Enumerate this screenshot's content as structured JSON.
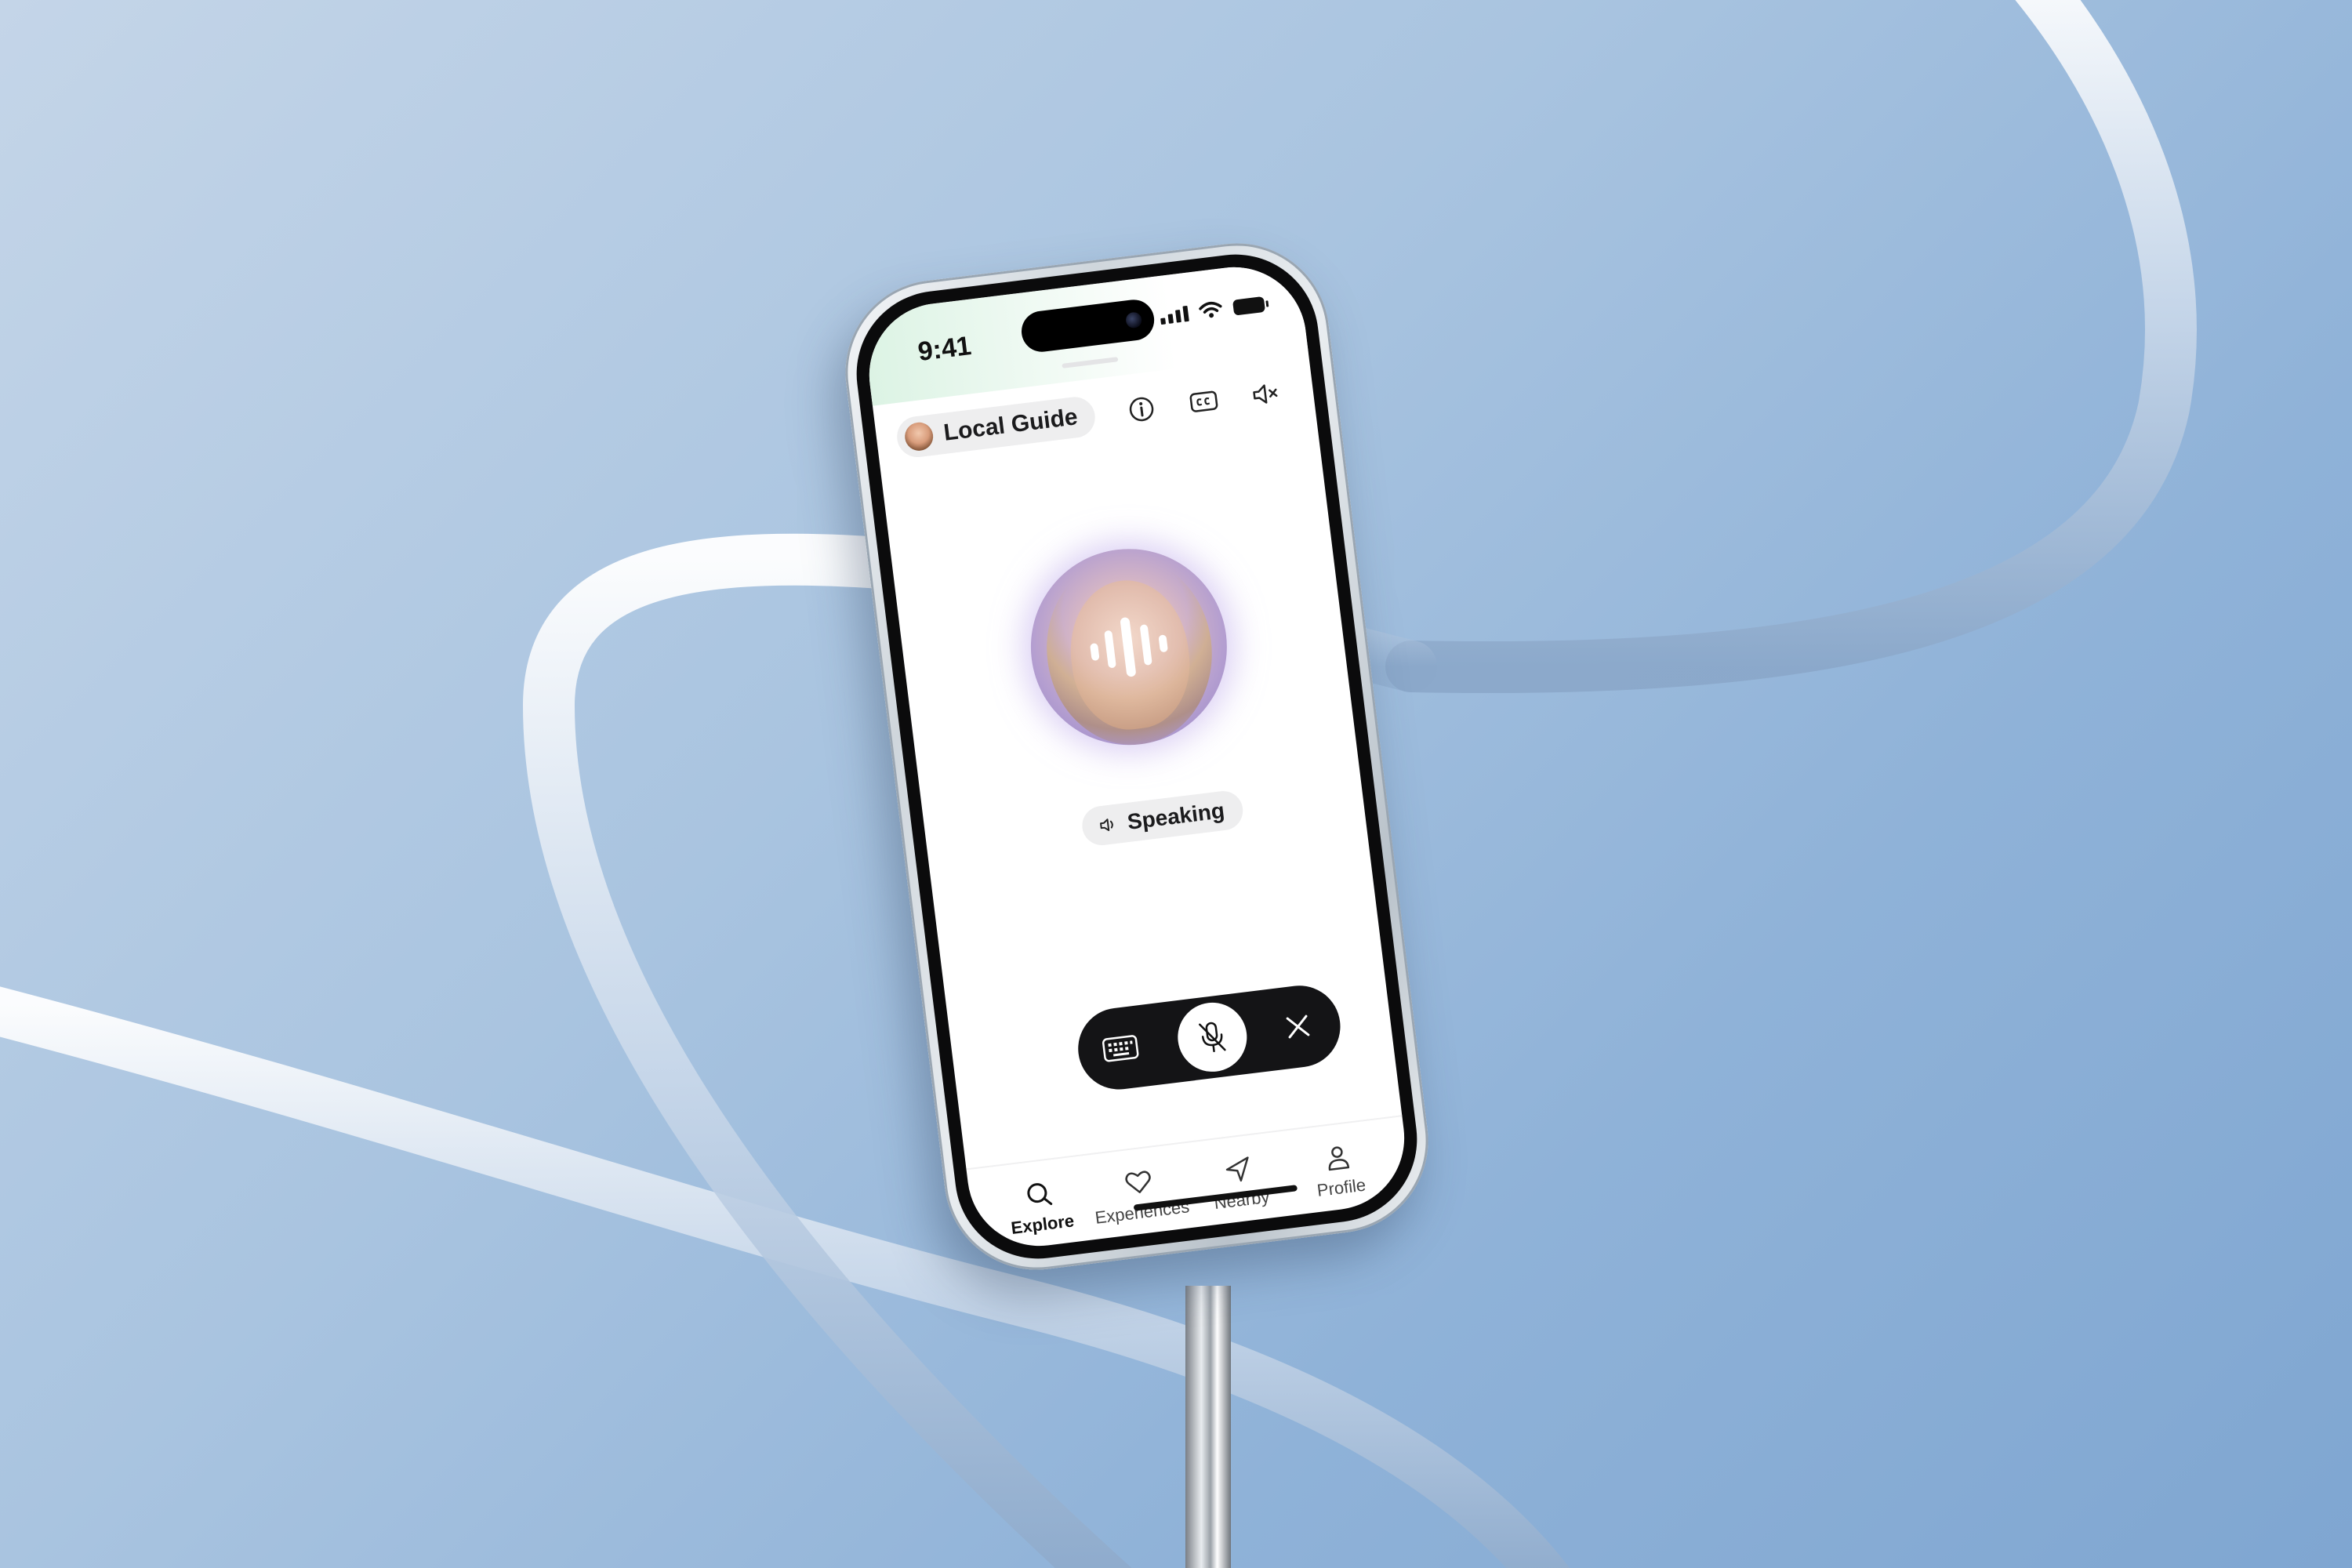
{
  "status_bar": {
    "time": "9:41"
  },
  "header": {
    "guide_label": "Local Guide",
    "icons": [
      "info-icon",
      "closed-captions-icon",
      "mute-icon"
    ]
  },
  "avatar": {
    "state_label": "Speaking",
    "state_icon": "speaker-icon",
    "overlay_icon": "soundwave-icon"
  },
  "controls": {
    "items": [
      "keyboard-icon",
      "mic-off-icon",
      "close-icon"
    ]
  },
  "tabs": [
    {
      "label": "Explore",
      "icon": "search-icon",
      "active": true
    },
    {
      "label": "Experiences",
      "icon": "heart-icon",
      "active": false
    },
    {
      "label": "Nearby",
      "icon": "navigation-icon",
      "active": false
    },
    {
      "label": "Profile",
      "icon": "person-icon",
      "active": false
    }
  ],
  "colors": {
    "background": "#8fb2d8",
    "control_bar": "#141416",
    "chip": "#eeeeef",
    "avatar_glow": "#b59fd0"
  }
}
